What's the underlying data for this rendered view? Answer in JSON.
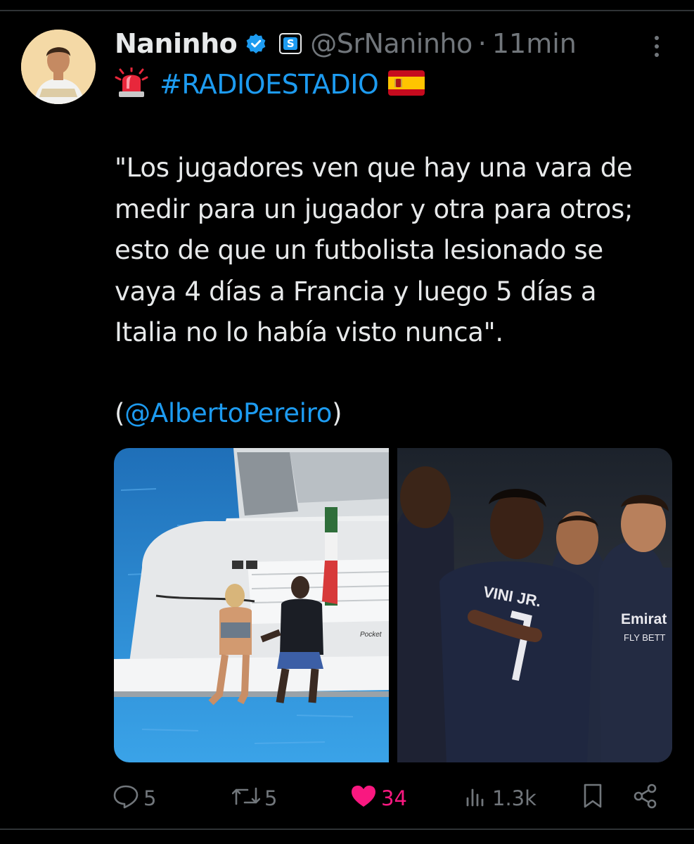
{
  "tweet": {
    "author_name": "Naninho",
    "handle": "@SrNaninho",
    "separator": "·",
    "time": "11min",
    "hashtag": "#RADIOESTADIO",
    "quote_lines": [
      "\"Los jugadores ven que hay una vara de",
      "medir para un jugador y otra para otros;",
      "esto de que un futbolista lesionado se",
      "vaya 4 días a Francia y luego 5 días a",
      "Italia no lo había visto nunca\"."
    ],
    "credit_open": "(",
    "mention": "@AlbertoPereiro",
    "credit_close": ")",
    "subscription_badge": "S",
    "jersey_text": "VINI JR.",
    "sponsor_line1": "Emirat",
    "sponsor_line2": "FLY BETT",
    "boat_name": "Pocket"
  },
  "actions": {
    "replies": "5",
    "reposts": "5",
    "likes": "34",
    "views": "1.3k"
  },
  "icons": {
    "verified": "verified-badge-icon",
    "subscription": "subscription-badge-icon",
    "siren": "rotating-light-emoji-icon",
    "flag": "spain-flag-emoji-icon",
    "more": "more-options-icon",
    "reply": "reply-icon",
    "repost": "repost-icon",
    "like": "heart-icon",
    "views": "views-icon",
    "bookmark": "bookmark-icon",
    "share": "share-icon"
  },
  "colors": {
    "background": "#000000",
    "text": "#e7e9ea",
    "secondary": "#71767b",
    "link": "#1d9bf0",
    "like": "#f91880"
  }
}
